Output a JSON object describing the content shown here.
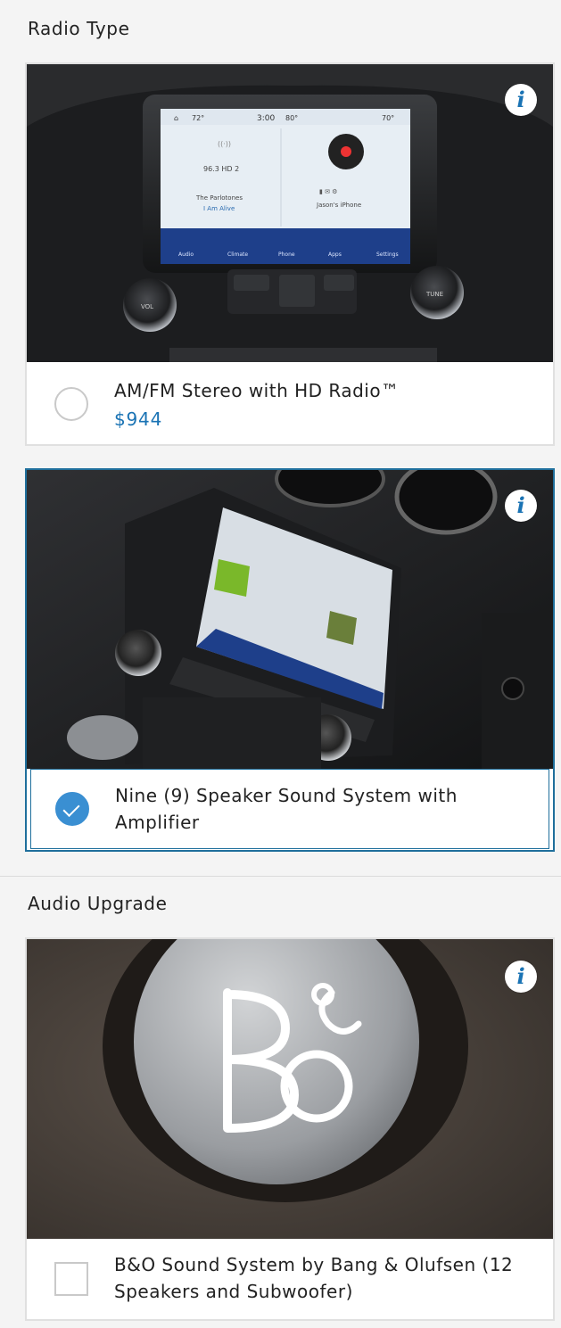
{
  "colors": {
    "accent": "#1a73b4",
    "selected_border": "#1f6f9c",
    "check_fill": "#3a8fd2",
    "background": "#f4f4f4"
  },
  "sections": {
    "radio_type": {
      "title": "Radio Type",
      "options": [
        {
          "label": "AM/FM Stereo with HD Radio™",
          "price": "$944",
          "selected": false,
          "info_icon": "i",
          "screen": {
            "temp_left": "72°",
            "time": "3:00",
            "temp_mid": "80°",
            "temp_right": "70°",
            "station": "96.3 HD 2",
            "artist": "The Parlotones",
            "song": "I Am Alive",
            "phone": "Jason's iPhone",
            "nav": [
              "Audio",
              "Climate",
              "Phone",
              "Apps",
              "Settings"
            ],
            "knob_left": "VOL",
            "knob_right": "TUNE"
          }
        },
        {
          "label": "Nine (9) Speaker Sound System with Amplifier",
          "selected": true,
          "info_icon": "i"
        }
      ]
    },
    "audio_upgrade": {
      "title": "Audio Upgrade",
      "options": [
        {
          "label": "B&O Sound System by Bang & Olufsen (12 Speakers and Subwoofer)",
          "selected": false,
          "info_icon": "i"
        }
      ]
    }
  }
}
